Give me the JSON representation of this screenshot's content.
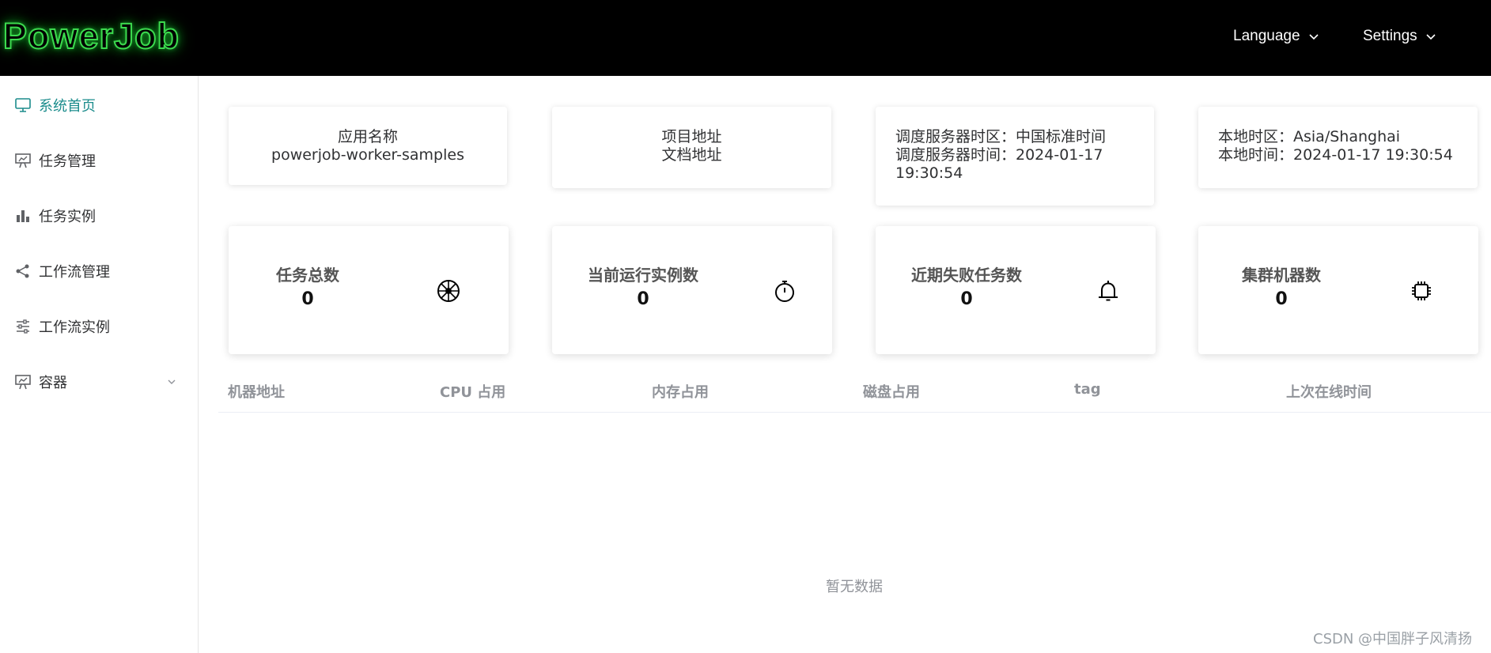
{
  "header": {
    "logo": "PowerJob",
    "language_label": "Language",
    "settings_label": "Settings"
  },
  "sidebar": {
    "items": [
      {
        "label": "系统首页",
        "icon": "monitor-icon",
        "active": true
      },
      {
        "label": "任务管理",
        "icon": "presentation-icon"
      },
      {
        "label": "任务实例",
        "icon": "bar-chart-icon"
      },
      {
        "label": "工作流管理",
        "icon": "share-icon"
      },
      {
        "label": "工作流实例",
        "icon": "sliders-icon"
      },
      {
        "label": "容器",
        "icon": "presentation-icon",
        "has_submenu": true
      }
    ]
  },
  "info": {
    "app": {
      "line1": "应用名称",
      "line2": "powerjob-worker-samples"
    },
    "links": {
      "line1": "项目地址",
      "line2": "文档地址"
    },
    "server": {
      "timezone": "调度服务器时区：中国标准时间",
      "time": "调度服务器时间：2024-01-17 19:30:54"
    },
    "local": {
      "timezone": "本地时区：Asia/Shanghai",
      "time": "本地时间：2024-01-17 19:30:54"
    }
  },
  "stats": [
    {
      "title": "任务总数",
      "value": "0",
      "icon": "wheel-icon"
    },
    {
      "title": "当前运行实例数",
      "value": "0",
      "icon": "stopwatch-icon"
    },
    {
      "title": "近期失败任务数",
      "value": "0",
      "icon": "bell-icon"
    },
    {
      "title": "集群机器数",
      "value": "0",
      "icon": "cpu-chip-icon"
    }
  ],
  "table": {
    "columns": [
      "机器地址",
      "CPU 占用",
      "内存占用",
      "磁盘占用",
      "tag",
      "上次在线时间"
    ],
    "empty_text": "暂无数据"
  },
  "watermark": "CSDN @中国胖子风清扬",
  "colors": {
    "accent": "#1b8c8c",
    "header_bg": "#000000",
    "logo_glow": "#3cd94e"
  }
}
